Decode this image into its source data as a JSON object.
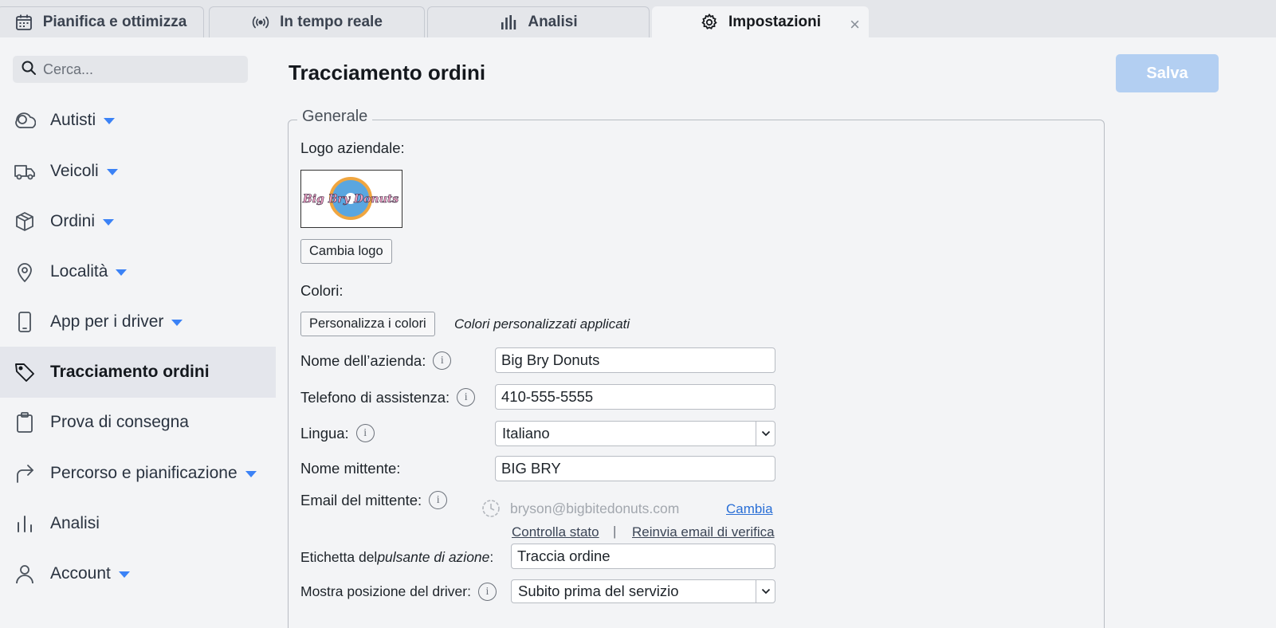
{
  "tabs": [
    {
      "label": "Pianifica e ottimizza",
      "icon": "calendar-icon"
    },
    {
      "label": "In tempo reale",
      "icon": "broadcast-icon"
    },
    {
      "label": "Analisi",
      "icon": "bar-chart-icon"
    },
    {
      "label": "Impostazioni",
      "icon": "gear-icon",
      "active": true,
      "close": "×"
    }
  ],
  "sidebar": {
    "search_placeholder": "Cerca...",
    "items": [
      {
        "label": "Autisti",
        "icon": "drivers-icon",
        "caret": true
      },
      {
        "label": "Veicoli",
        "icon": "truck-icon",
        "caret": true
      },
      {
        "label": "Ordini",
        "icon": "box-icon",
        "caret": true
      },
      {
        "label": "Località",
        "icon": "location-pin-icon",
        "caret": true
      },
      {
        "label": "App per i driver",
        "icon": "phone-icon",
        "caret": true
      },
      {
        "label": "Tracciamento ordini",
        "icon": "tag-icon",
        "active": true
      },
      {
        "label": "Prova di consegna",
        "icon": "clipboard-icon"
      },
      {
        "label": "Percorso e pianificazione",
        "icon": "route-arrow-icon",
        "caret": true
      },
      {
        "label": "Analisi",
        "icon": "bar-chart-icon"
      },
      {
        "label": "Account",
        "icon": "user-icon",
        "caret": true
      }
    ]
  },
  "main": {
    "title": "Tracciamento ordini",
    "save_label": "Salva",
    "section_legend": "Generale",
    "logo_label": "Logo aziendale:",
    "logo_text": "Big Bry Donuts",
    "change_logo_label": "Cambia logo",
    "colors_label": "Colori:",
    "customize_colors_label": "Personalizza i colori",
    "colors_note": "Colori personalizzati applicati",
    "company_name_label": "Nome dell’azienda:",
    "company_name_value": "Big Bry Donuts",
    "support_phone_label": "Telefono di assistenza:",
    "support_phone_value": "410-555-5555",
    "language_label": "Lingua:",
    "language_value": "Italiano",
    "sender_name_label": "Nome mittente:",
    "sender_name_value": "BIG BRY",
    "sender_email_label": "Email del mittente:",
    "sender_email_value": "bryson@bigbitedonuts.com",
    "change_link": "Cambia",
    "check_status_link": "Controlla stato",
    "separator": "|",
    "resend_link": "Reinvia email di verifica",
    "action_label_prefix": "Etichetta del ",
    "action_label_italic": "pulsante di azione",
    "action_label_suffix": ":",
    "action_label_value": "Traccia ordine",
    "driver_position_label": "Mostra posizione del driver:",
    "driver_position_value": "Subito prima del servizio",
    "info_glyph": "i"
  }
}
